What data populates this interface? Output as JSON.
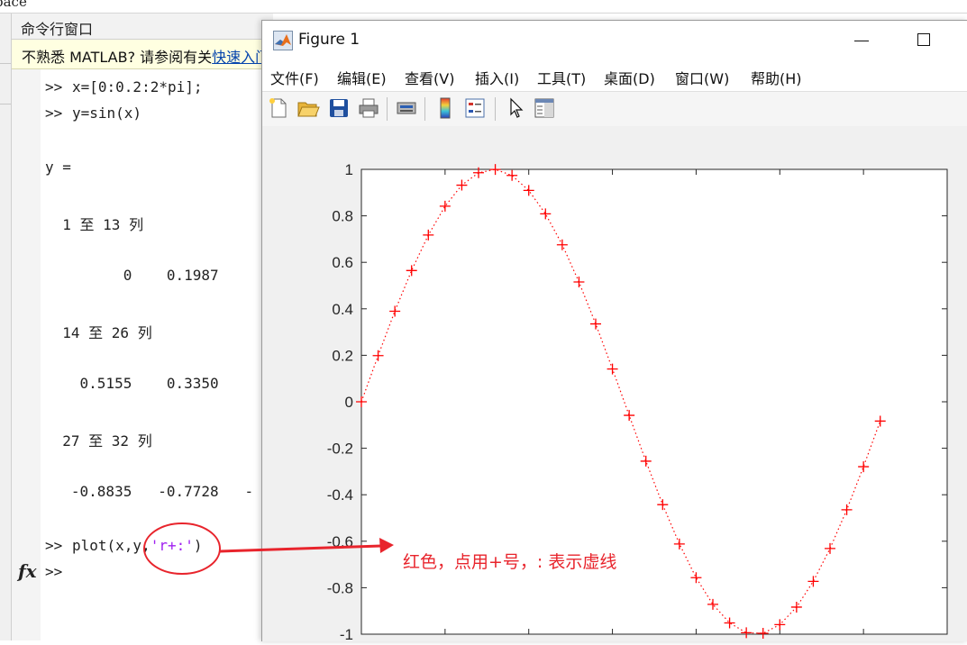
{
  "top_strip_text": "pace",
  "command_window": {
    "title": "命令行窗口",
    "notice_text": "不熟悉 MATLAB? 请参阅有关",
    "notice_link": "快速入门",
    "lines": [
      {
        "prompt": ">>",
        "text": "x=[0:0.2:2*pi];"
      },
      {
        "prompt": ">>",
        "text": "y=sin(x)"
      },
      {
        "prompt": "",
        "text": "y ="
      },
      {
        "prompt": "",
        "text": "  1 至 13 列"
      },
      {
        "prompt": "",
        "text": "         0    0.1987"
      },
      {
        "prompt": "",
        "text": "  14 至 26 列"
      },
      {
        "prompt": "",
        "text": "    0.5155    0.3350"
      },
      {
        "prompt": "",
        "text": "  27 至 32 列"
      },
      {
        "prompt": "",
        "text": "   -0.8835   -0.7728   -"
      }
    ],
    "plot_command_prefix": "plot(x,y,",
    "plot_command_string": "'r+:'",
    "plot_command_suffix": ")",
    "prompt": ">>",
    "fx_label": "fx"
  },
  "figure": {
    "title": "Figure 1",
    "menu": [
      "文件(F)",
      "编辑(E)",
      "查看(V)",
      "插入(I)",
      "工具(T)",
      "桌面(D)",
      "窗口(W)",
      "帮助(H)"
    ],
    "toolbar_icons": [
      "new-figure-icon",
      "open-folder-icon",
      "save-icon",
      "print-icon",
      "link-plot-icon",
      "colorbar-icon",
      "legend-icon",
      "pointer-icon",
      "property-editor-icon"
    ]
  },
  "annotation": {
    "text": "红色，点用+号，: 表示虚线",
    "color": "#e8242c"
  },
  "chart_data": {
    "type": "line",
    "title": "",
    "xlabel": "",
    "ylabel": "",
    "line_style": "dotted",
    "marker": "+",
    "color": "#ff0000",
    "xlim": [
      0,
      7
    ],
    "ylim": [
      -1,
      1
    ],
    "yticks": [
      "1",
      "0.8",
      "0.6",
      "0.4",
      "0.2",
      "0",
      "-0.2",
      "-0.4",
      "-0.6",
      "-0.8",
      "-1"
    ],
    "x": [
      0.0,
      0.2,
      0.4,
      0.6,
      0.8,
      1.0,
      1.2,
      1.4,
      1.6,
      1.8,
      2.0,
      2.2,
      2.4,
      2.6,
      2.8,
      3.0,
      3.2,
      3.4,
      3.6,
      3.8,
      4.0,
      4.2,
      4.4,
      4.6,
      4.8,
      5.0,
      5.2,
      5.4,
      5.6,
      5.8,
      6.0,
      6.2
    ],
    "y": [
      0.0,
      0.1987,
      0.3894,
      0.5646,
      0.7174,
      0.8415,
      0.932,
      0.9854,
      0.9996,
      0.9738,
      0.9093,
      0.8085,
      0.6755,
      0.5155,
      0.335,
      0.1411,
      -0.0584,
      -0.2555,
      -0.4425,
      -0.6119,
      -0.7568,
      -0.8716,
      -0.9516,
      -0.9937,
      -0.9962,
      -0.9589,
      -0.8835,
      -0.7728,
      -0.6313,
      -0.4646,
      -0.2794,
      -0.0831
    ]
  }
}
